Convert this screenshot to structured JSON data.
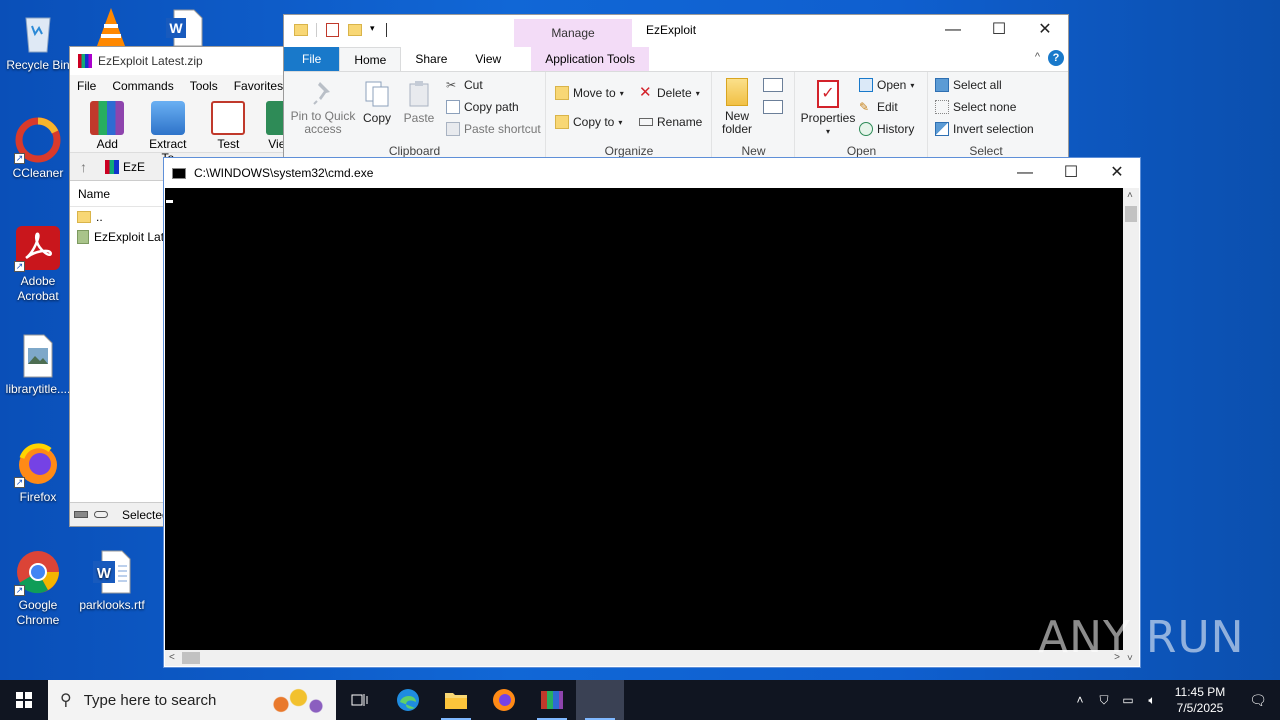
{
  "desktop": {
    "icons": [
      {
        "label": "Recycle Bin"
      },
      {
        "label": "CCleaner"
      },
      {
        "label": "Adobe Acrobat"
      },
      {
        "label": "librarytitle...."
      },
      {
        "label": "Firefox"
      },
      {
        "label": "Google Chrome"
      },
      {
        "label": "parklooks.rtf"
      }
    ]
  },
  "winrar": {
    "title": "EzExploit Latest.zip",
    "menu": [
      "File",
      "Commands",
      "Tools",
      "Favorites"
    ],
    "toolbar": [
      "Add",
      "Extract To",
      "Test",
      "Vie"
    ],
    "address": "EzE",
    "column_header": "Name",
    "rows": [
      "..",
      "EzExploit Late"
    ],
    "status": "Selected"
  },
  "explorer": {
    "title": "EzExploit",
    "contextual_tab": "Manage",
    "tabs": [
      "File",
      "Home",
      "Share",
      "View",
      "Application Tools"
    ],
    "groups": {
      "clipboard": {
        "label": "Clipboard",
        "pin": "Pin to Quick access",
        "copy": "Copy",
        "paste": "Paste",
        "cut": "Cut",
        "copy_path": "Copy path",
        "paste_shortcut": "Paste shortcut"
      },
      "organize": {
        "label": "Organize",
        "move_to": "Move to",
        "copy_to": "Copy to",
        "delete": "Delete",
        "rename": "Rename"
      },
      "new": {
        "label": "New",
        "new_folder": "New folder"
      },
      "open": {
        "label": "Open",
        "properties": "Properties",
        "open": "Open",
        "edit": "Edit",
        "history": "History"
      },
      "select": {
        "label": "Select",
        "select_all": "Select all",
        "select_none": "Select none",
        "invert": "Invert selection"
      }
    }
  },
  "cmd": {
    "title": "C:\\WINDOWS\\system32\\cmd.exe"
  },
  "taskbar": {
    "search_placeholder": "Type here to search",
    "time": "11:45 PM",
    "date": "7/5/2025"
  },
  "watermark": "ANY RUN",
  "colors": {
    "desktop": "#0f5fcf",
    "taskbar": "#101521",
    "ribbon_file_tab": "#1979ca",
    "contextual_tab": "#f3dcf7"
  }
}
